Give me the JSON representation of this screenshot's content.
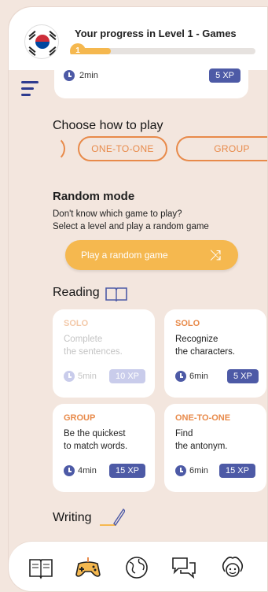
{
  "header": {
    "progress_title": "Your progress in Level 1 - Games",
    "level_number": "1",
    "progress_fraction": 0.2
  },
  "prev_card": {
    "time": "2min",
    "xp": "5 XP"
  },
  "choose": {
    "title": "Choose how to play",
    "options": [
      "ONE-TO-ONE",
      "GROUP"
    ]
  },
  "random": {
    "title": "Random mode",
    "line1": "Don't know which game to play?",
    "line2": "Select a level and play a random game",
    "button_label": "Play a random game"
  },
  "reading": {
    "title": "Reading",
    "cards": [
      {
        "mode": "SOLO",
        "line1": "Complete",
        "line2": "the sentences.",
        "time": "5min",
        "xp": "10 XP"
      },
      {
        "mode": "SOLO",
        "line1": "Recognize",
        "line2": "the characters.",
        "time": "6min",
        "xp": "5 XP"
      },
      {
        "mode": "GROUP",
        "line1": "Be the quickest",
        "line2": "to match words.",
        "time": "4min",
        "xp": "15 XP"
      },
      {
        "mode": "ONE-TO-ONE",
        "line1": "Find",
        "line2": "the antonym.",
        "time": "6min",
        "xp": "15 XP"
      }
    ]
  },
  "writing": {
    "title": "Writing"
  },
  "tabs": [
    "book-icon",
    "gamepad-icon",
    "globe-icon",
    "chat-icon",
    "avatar-icon"
  ],
  "colors": {
    "accent": "#e88a4a",
    "brand": "#4d5aa6",
    "yellow": "#f5b84f",
    "background": "#f3e6de"
  }
}
